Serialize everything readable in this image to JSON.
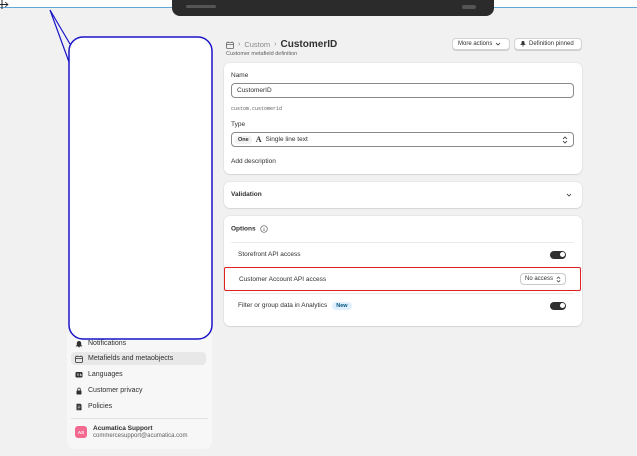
{
  "header": {
    "breadcrumb_parent": "Custom",
    "title": "CustomerID",
    "subtitle": "Customer metafield definition",
    "more_actions_label": "More actions",
    "definition_pinned_label": "Definition pinned"
  },
  "definition": {
    "name_label": "Name",
    "name_value": "CustomerID",
    "namespace_key": "custom.customerid",
    "type_label": "Type",
    "type_badge": "One",
    "type_glyph": "A",
    "type_value": "Single line text",
    "add_description_label": "Add description"
  },
  "validation": {
    "title": "Validation"
  },
  "options": {
    "title": "Options",
    "rows": [
      {
        "label": "Storefront API access"
      },
      {
        "label": "Customer Account API access",
        "select_value": "No access"
      },
      {
        "label": "Filter or group data in Analytics",
        "badge": "New"
      }
    ]
  },
  "sidebar": {
    "items": [
      {
        "label": "Notifications",
        "icon": "bell-icon"
      },
      {
        "label": "Metafields and metaobjects",
        "icon": "metafields-icon"
      },
      {
        "label": "Languages",
        "icon": "languages-icon"
      },
      {
        "label": "Customer privacy",
        "icon": "lock-icon"
      },
      {
        "label": "Policies",
        "icon": "policies-icon"
      }
    ],
    "account_initials": "AS",
    "account_name": "Acumatica Support",
    "account_email": "commercesupport@acumatica.com"
  },
  "colors": {
    "highlight": "#e02020",
    "annotation": "#1a14c8",
    "avatar": "#f46a8f",
    "toggle_on": "#303030"
  }
}
